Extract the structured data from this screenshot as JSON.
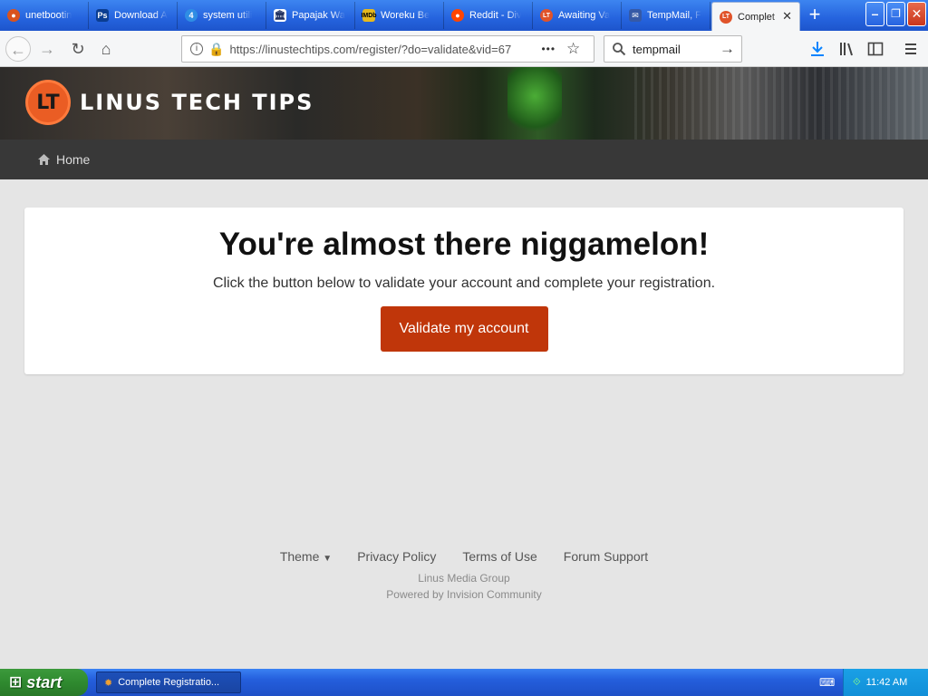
{
  "tabs": [
    {
      "label": "unetbootin",
      "favicon": "generic-icon",
      "color": "#d9531e"
    },
    {
      "label": "Download A",
      "favicon": "ps-icon",
      "color": "#0b3d91"
    },
    {
      "label": "system utili",
      "favicon": "4-icon",
      "color": "#2f8de4"
    },
    {
      "label": "Papajak Wa",
      "favicon": "building-icon",
      "color": "#1f2f5f"
    },
    {
      "label": "Woreku Be",
      "favicon": "imdb-icon",
      "color": "#e6b91e"
    },
    {
      "label": "Reddit - Div",
      "favicon": "reddit-icon",
      "color": "#ff4500"
    },
    {
      "label": "Awaiting Va",
      "favicon": "ltt-icon",
      "color": "#e0532a"
    },
    {
      "label": "TempMail, F",
      "favicon": "tempmail-icon",
      "color": "#3559a6"
    },
    {
      "label": "Complet",
      "favicon": "ltt-icon",
      "color": "#e0532a"
    }
  ],
  "window_controls": {
    "minimize": "–",
    "restore": "❐",
    "close": "✕"
  },
  "nav": {
    "url": "https://linustechtips.com/register/?do=validate&vid=67",
    "search": "tempmail",
    "more_dots": "•••"
  },
  "site": {
    "logo_text": "LINUS TECH TIPS",
    "logo_mark": "LT",
    "nav_home": "Home"
  },
  "card": {
    "heading": "You're almost there niggamelon!",
    "subtext": "Click the button below to validate your account and complete your registration.",
    "button": "Validate my account"
  },
  "footer": {
    "theme": "Theme",
    "privacy": "Privacy Policy",
    "terms": "Terms of Use",
    "support": "Forum Support",
    "company": "Linus Media Group",
    "powered": "Powered by Invision Community"
  },
  "taskbar": {
    "start": "start",
    "task": "Complete Registratio...",
    "clock": "11:42 AM"
  },
  "colors": {
    "accent": "#c0360a",
    "ltt_orange": "#ea5d24",
    "lock_green": "#1fa21f"
  }
}
